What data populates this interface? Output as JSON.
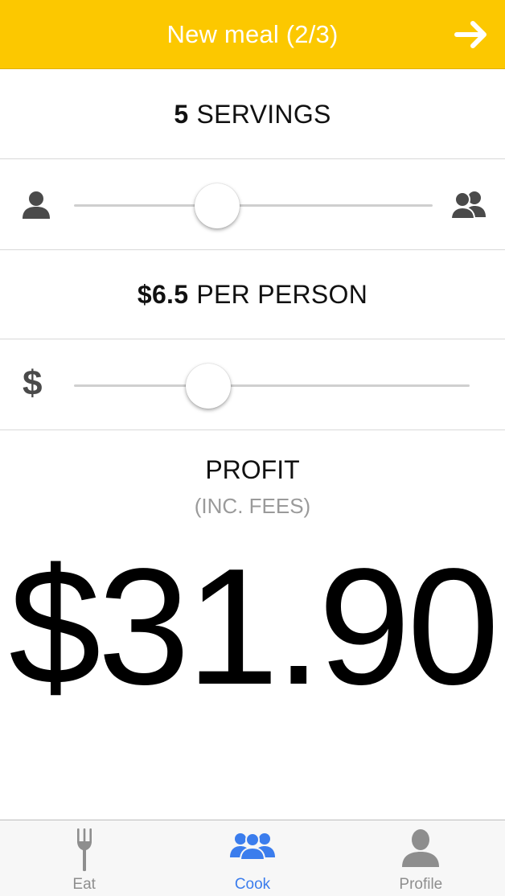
{
  "header": {
    "title": "New meal (2/3)",
    "background": "#fcc800",
    "next_icon": "arrow-right-icon"
  },
  "servings": {
    "value": "5",
    "unit": "SERVINGS",
    "slider_fraction": 0.4,
    "left_icon": "single-person-icon",
    "right_icon": "group-people-icon"
  },
  "price": {
    "value": "$6.5",
    "unit": "PER PERSON",
    "slider_fraction": 0.34,
    "icon_glyph": "$"
  },
  "profit": {
    "label": "PROFIT",
    "sublabel": "(INC. FEES)",
    "amount": "$31.90"
  },
  "tabbar": {
    "active_color": "#3b7ded",
    "inactive_color": "#8e8e8e",
    "tabs": [
      {
        "label": "Eat",
        "icon": "fork-icon",
        "active": false
      },
      {
        "label": "Cook",
        "icon": "group-icon",
        "active": true
      },
      {
        "label": "Profile",
        "icon": "person-icon",
        "active": false
      }
    ]
  }
}
